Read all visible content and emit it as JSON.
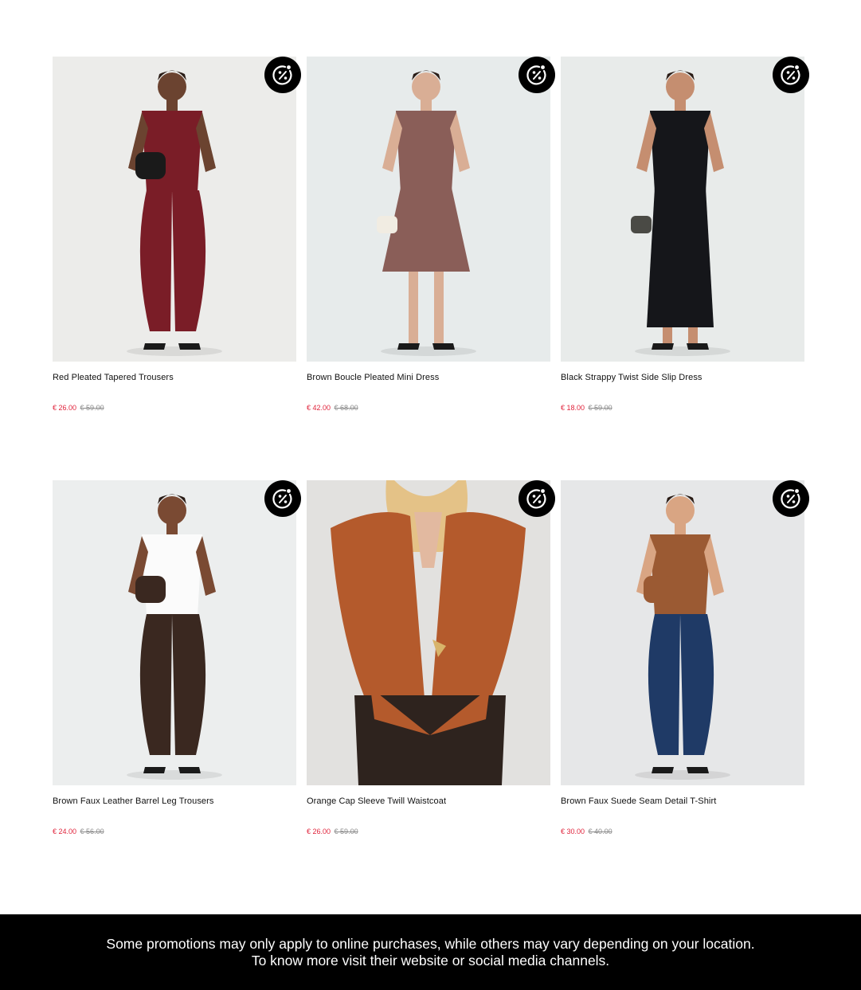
{
  "products": [
    {
      "name": "Red Pleated Tapered Trousers",
      "price": "€ 26.00",
      "old_price": "€ 59.00",
      "image_desc": "model-in-red-jumpsuit",
      "colors": {
        "bg": "#ececea",
        "garment": "#7a1d27",
        "skin": "#6b4330",
        "accessory": "#1a1a1a"
      }
    },
    {
      "name": "Brown Boucle Pleated Mini Dress",
      "price": "€ 42.00",
      "old_price": "€ 68.00",
      "image_desc": "model-in-boucle-mini-dress",
      "colors": {
        "bg": "#e7ebeb",
        "garment": "#8a5e58",
        "skin": "#d9ae95",
        "accessory": "#f1ece2"
      }
    },
    {
      "name": "Black Strappy Twist Side Slip Dress",
      "price": "€ 18.00",
      "old_price": "€ 59.00",
      "image_desc": "model-in-black-slip-dress",
      "colors": {
        "bg": "#e8ebea",
        "garment": "#15161a",
        "skin": "#c58e70",
        "accessory": "#4a4a45"
      }
    },
    {
      "name": "Brown Faux Leather Barrel Leg Trousers",
      "price": "€ 24.00",
      "old_price": "€ 56.00",
      "image_desc": "model-in-white-top-and-brown-trousers",
      "colors": {
        "bg": "#eceeee",
        "garment": "#3a2820",
        "skin": "#7a4a33",
        "accessory": "#fbfbfb"
      }
    },
    {
      "name": "Orange Cap Sleeve Twill Waistcoat",
      "price": "€ 26.00",
      "old_price": "€ 59.00",
      "image_desc": "closeup-orange-waistcoat",
      "colors": {
        "bg": "#e2e1df",
        "garment": "#b45a2c",
        "skin": "#e2b9a0",
        "accessory": "#2e231e"
      }
    },
    {
      "name": "Brown Faux Suede Seam Detail T-Shirt",
      "price": "€ 30.00",
      "old_price": "€ 40.00",
      "image_desc": "model-in-brown-tshirt-and-jeans",
      "colors": {
        "bg": "#e6e7e8",
        "garment": "#9b5a33",
        "skin": "#d9a583",
        "accessory": "#1f3a66"
      }
    }
  ],
  "badge_icon": "discount-percent-icon",
  "footer": {
    "line1": "Some promotions may only apply to online purchases, while others may vary depending on your location.",
    "line2": "To know more visit their website or social media channels."
  }
}
